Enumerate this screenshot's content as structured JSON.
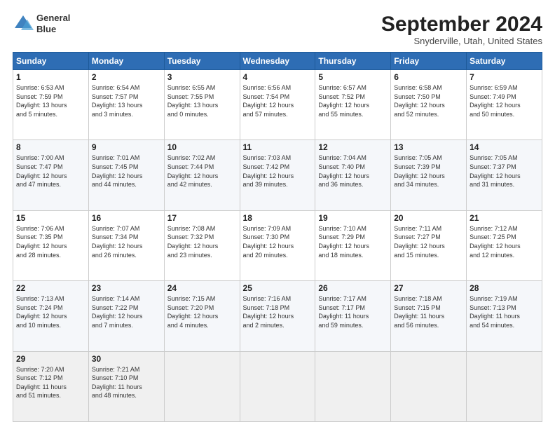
{
  "logo": {
    "line1": "General",
    "line2": "Blue"
  },
  "title": "September 2024",
  "subtitle": "Snyderville, Utah, United States",
  "days_header": [
    "Sunday",
    "Monday",
    "Tuesday",
    "Wednesday",
    "Thursday",
    "Friday",
    "Saturday"
  ],
  "weeks": [
    [
      {
        "day": "1",
        "info": "Sunrise: 6:53 AM\nSunset: 7:59 PM\nDaylight: 13 hours\nand 5 minutes."
      },
      {
        "day": "2",
        "info": "Sunrise: 6:54 AM\nSunset: 7:57 PM\nDaylight: 13 hours\nand 3 minutes."
      },
      {
        "day": "3",
        "info": "Sunrise: 6:55 AM\nSunset: 7:55 PM\nDaylight: 13 hours\nand 0 minutes."
      },
      {
        "day": "4",
        "info": "Sunrise: 6:56 AM\nSunset: 7:54 PM\nDaylight: 12 hours\nand 57 minutes."
      },
      {
        "day": "5",
        "info": "Sunrise: 6:57 AM\nSunset: 7:52 PM\nDaylight: 12 hours\nand 55 minutes."
      },
      {
        "day": "6",
        "info": "Sunrise: 6:58 AM\nSunset: 7:50 PM\nDaylight: 12 hours\nand 52 minutes."
      },
      {
        "day": "7",
        "info": "Sunrise: 6:59 AM\nSunset: 7:49 PM\nDaylight: 12 hours\nand 50 minutes."
      }
    ],
    [
      {
        "day": "8",
        "info": "Sunrise: 7:00 AM\nSunset: 7:47 PM\nDaylight: 12 hours\nand 47 minutes."
      },
      {
        "day": "9",
        "info": "Sunrise: 7:01 AM\nSunset: 7:45 PM\nDaylight: 12 hours\nand 44 minutes."
      },
      {
        "day": "10",
        "info": "Sunrise: 7:02 AM\nSunset: 7:44 PM\nDaylight: 12 hours\nand 42 minutes."
      },
      {
        "day": "11",
        "info": "Sunrise: 7:03 AM\nSunset: 7:42 PM\nDaylight: 12 hours\nand 39 minutes."
      },
      {
        "day": "12",
        "info": "Sunrise: 7:04 AM\nSunset: 7:40 PM\nDaylight: 12 hours\nand 36 minutes."
      },
      {
        "day": "13",
        "info": "Sunrise: 7:05 AM\nSunset: 7:39 PM\nDaylight: 12 hours\nand 34 minutes."
      },
      {
        "day": "14",
        "info": "Sunrise: 7:05 AM\nSunset: 7:37 PM\nDaylight: 12 hours\nand 31 minutes."
      }
    ],
    [
      {
        "day": "15",
        "info": "Sunrise: 7:06 AM\nSunset: 7:35 PM\nDaylight: 12 hours\nand 28 minutes."
      },
      {
        "day": "16",
        "info": "Sunrise: 7:07 AM\nSunset: 7:34 PM\nDaylight: 12 hours\nand 26 minutes."
      },
      {
        "day": "17",
        "info": "Sunrise: 7:08 AM\nSunset: 7:32 PM\nDaylight: 12 hours\nand 23 minutes."
      },
      {
        "day": "18",
        "info": "Sunrise: 7:09 AM\nSunset: 7:30 PM\nDaylight: 12 hours\nand 20 minutes."
      },
      {
        "day": "19",
        "info": "Sunrise: 7:10 AM\nSunset: 7:29 PM\nDaylight: 12 hours\nand 18 minutes."
      },
      {
        "day": "20",
        "info": "Sunrise: 7:11 AM\nSunset: 7:27 PM\nDaylight: 12 hours\nand 15 minutes."
      },
      {
        "day": "21",
        "info": "Sunrise: 7:12 AM\nSunset: 7:25 PM\nDaylight: 12 hours\nand 12 minutes."
      }
    ],
    [
      {
        "day": "22",
        "info": "Sunrise: 7:13 AM\nSunset: 7:24 PM\nDaylight: 12 hours\nand 10 minutes."
      },
      {
        "day": "23",
        "info": "Sunrise: 7:14 AM\nSunset: 7:22 PM\nDaylight: 12 hours\nand 7 minutes."
      },
      {
        "day": "24",
        "info": "Sunrise: 7:15 AM\nSunset: 7:20 PM\nDaylight: 12 hours\nand 4 minutes."
      },
      {
        "day": "25",
        "info": "Sunrise: 7:16 AM\nSunset: 7:18 PM\nDaylight: 12 hours\nand 2 minutes."
      },
      {
        "day": "26",
        "info": "Sunrise: 7:17 AM\nSunset: 7:17 PM\nDaylight: 11 hours\nand 59 minutes."
      },
      {
        "day": "27",
        "info": "Sunrise: 7:18 AM\nSunset: 7:15 PM\nDaylight: 11 hours\nand 56 minutes."
      },
      {
        "day": "28",
        "info": "Sunrise: 7:19 AM\nSunset: 7:13 PM\nDaylight: 11 hours\nand 54 minutes."
      }
    ],
    [
      {
        "day": "29",
        "info": "Sunrise: 7:20 AM\nSunset: 7:12 PM\nDaylight: 11 hours\nand 51 minutes."
      },
      {
        "day": "30",
        "info": "Sunrise: 7:21 AM\nSunset: 7:10 PM\nDaylight: 11 hours\nand 48 minutes."
      },
      {
        "day": "",
        "info": ""
      },
      {
        "day": "",
        "info": ""
      },
      {
        "day": "",
        "info": ""
      },
      {
        "day": "",
        "info": ""
      },
      {
        "day": "",
        "info": ""
      }
    ]
  ]
}
